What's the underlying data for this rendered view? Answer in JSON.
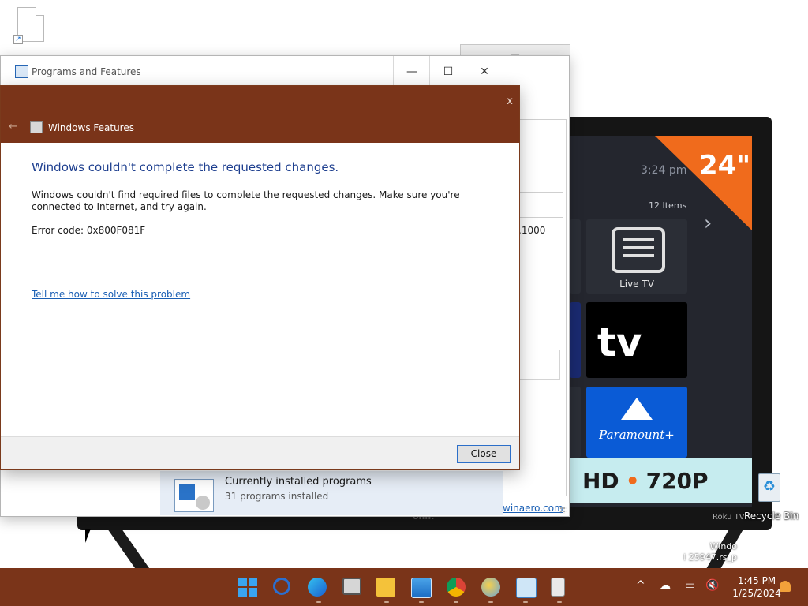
{
  "desktop": {
    "recycle_bin_label": "Recycle Bin",
    "watermark_line1": "Windo",
    "watermark_line2": "l 25947.rs_p"
  },
  "wallpaper": {
    "tv_time": "3:24 pm",
    "tv_items": "12 Items",
    "tv_badge": "24\"",
    "tile_live_tv": "Live TV",
    "tile_apple": "tv",
    "tile_paramount": "Paramount+",
    "banner_left": "HD",
    "banner_dot": "•",
    "banner_right": "720P",
    "brand": "onn.",
    "roku": "Roku TV"
  },
  "programs_features": {
    "title": "Programs and Features",
    "minimize": "—",
    "maximize": "☐",
    "close": "✕",
    "version_fragment": ".1000",
    "currently_installed": "Currently installed programs",
    "installed_count": "31 programs installed",
    "link": "winaero.com"
  },
  "windows_features": {
    "title": "Windows Features",
    "close": "x",
    "back": "←",
    "heading": "Windows couldn't complete the requested changes.",
    "message": "Windows couldn't find required files to complete the requested changes. Make sure you're connected to Internet, and try again.",
    "error_code": "Error code: 0x800F081F",
    "help_link": "Tell me how to solve this problem",
    "close_button": "Close"
  },
  "taskbar": {
    "time": "1:45 PM",
    "date": "1/25/2024",
    "tray_chevron": "^",
    "icons": [
      "windows-start-icon",
      "search-icon",
      "edge-pre-icon",
      "task-view-icon",
      "file-explorer-icon",
      "photos-icon",
      "chrome-icon",
      "paint-icon",
      "control-panel-icon",
      "notepad-icon"
    ]
  }
}
